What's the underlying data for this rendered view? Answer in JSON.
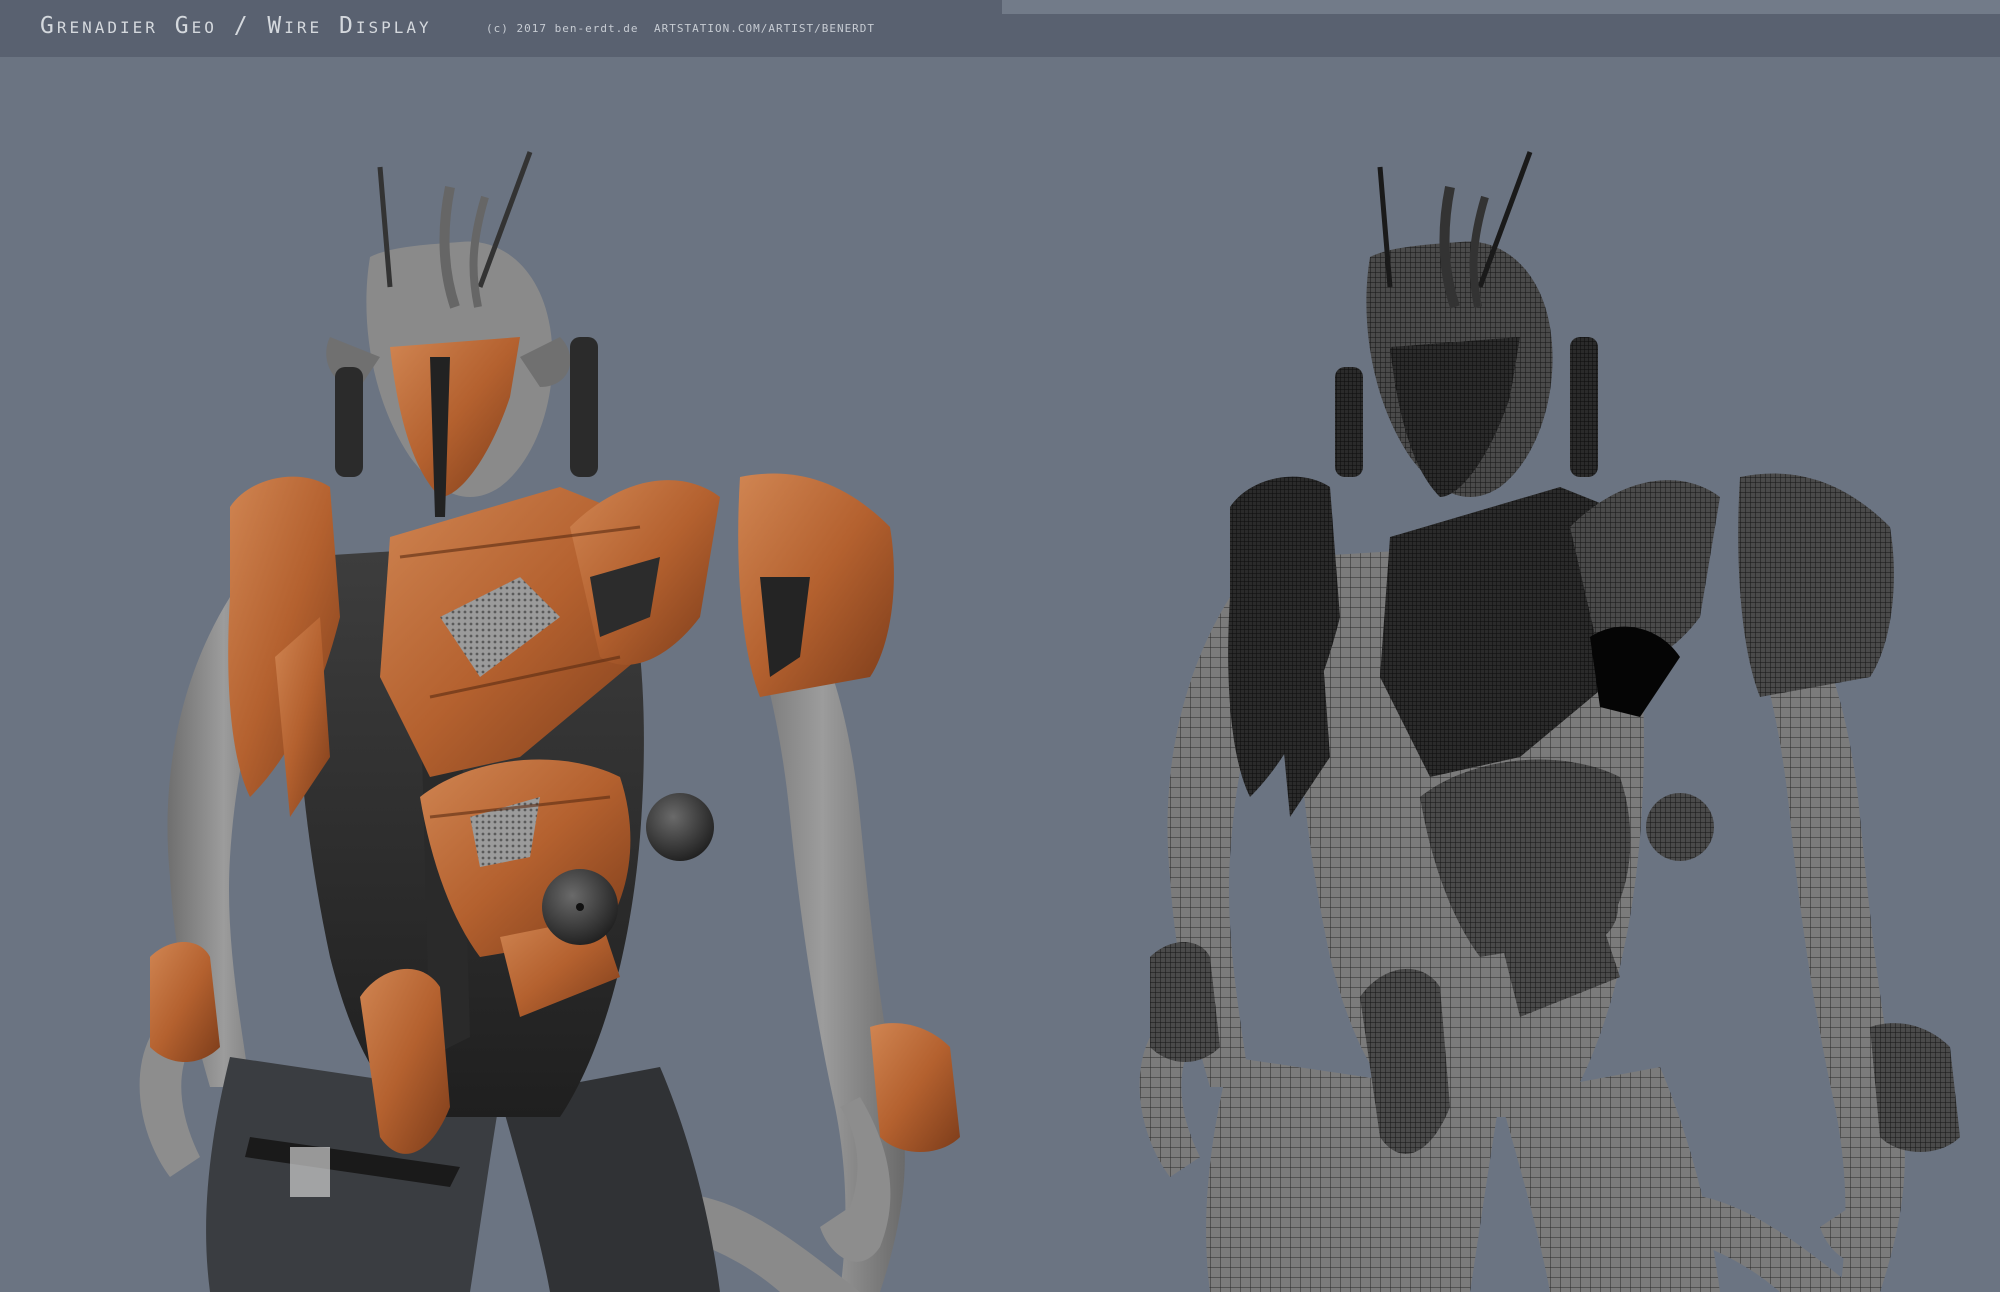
{
  "header": {
    "title": "Grenadier Geo / Wire Display",
    "copyright": "(c) 2017 ben-erdt.de",
    "link": "artstation.com/artist/benerdt"
  },
  "viewports": {
    "left": {
      "mode": "textured",
      "armor_color": "#b8673a",
      "skin_color": "#8f8f8f"
    },
    "right": {
      "mode": "wireframe",
      "mesh_color": "#2a2a2a",
      "skin_color": "#777777"
    }
  },
  "colors": {
    "background": "#6b7482",
    "header_bar": "#596170",
    "header_text": "#d4d8dd"
  }
}
